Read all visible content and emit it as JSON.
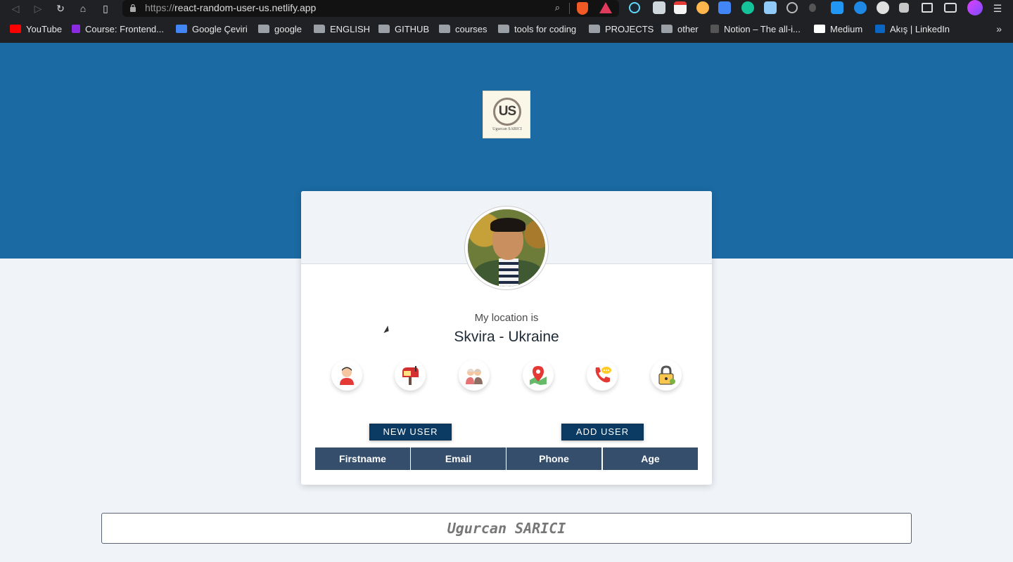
{
  "browser": {
    "url_scheme": "https://",
    "url_host": "react-random-user-us.netlify.app",
    "bookmarks": [
      {
        "label": "YouTube",
        "icon": "youtube-icon",
        "color": "#ff0000"
      },
      {
        "label": "Course: Frontend...",
        "icon": "course-icon",
        "color": "#8a2be2"
      },
      {
        "label": "Google Çeviri",
        "icon": "google-translate-icon",
        "color": "#4285f4"
      },
      {
        "label": "google",
        "icon": "folder-icon"
      },
      {
        "label": "ENGLISH",
        "icon": "folder-icon"
      },
      {
        "label": "GITHUB",
        "icon": "folder-icon"
      },
      {
        "label": "courses",
        "icon": "folder-icon"
      },
      {
        "label": "tools for coding",
        "icon": "folder-icon"
      },
      {
        "label": "PROJECTS",
        "icon": "folder-icon"
      },
      {
        "label": "other",
        "icon": "folder-icon"
      },
      {
        "label": "Notion – The all-i...",
        "icon": "notion-icon",
        "color": "#555555"
      },
      {
        "label": "Medium",
        "icon": "medium-icon",
        "color": "#ffffff"
      },
      {
        "label": "Akış | LinkedIn",
        "icon": "linkedin-icon",
        "color": "#0a66c2"
      }
    ],
    "more": "»"
  },
  "header": {
    "logo_text": "US",
    "logo_name": "Ugurcan SARICI"
  },
  "card": {
    "location_label": "My location is",
    "location_value": "Skvira - Ukraine",
    "icons": [
      "user-icon",
      "mailbox-icon",
      "elderly-couple-icon",
      "map-pin-icon",
      "phone-icon",
      "padlock-icon"
    ],
    "new_user_label": "NEW USER",
    "add_user_label": "ADD USER",
    "table_headers": [
      "Firstname",
      "Email",
      "Phone",
      "Age"
    ]
  },
  "footer": {
    "text": "Ugurcan SARICI"
  },
  "colors": {
    "hero": "#1b6aa3",
    "button": "#0b3a63",
    "table_header": "#344e6c",
    "page_bg": "#f0f4f8"
  }
}
